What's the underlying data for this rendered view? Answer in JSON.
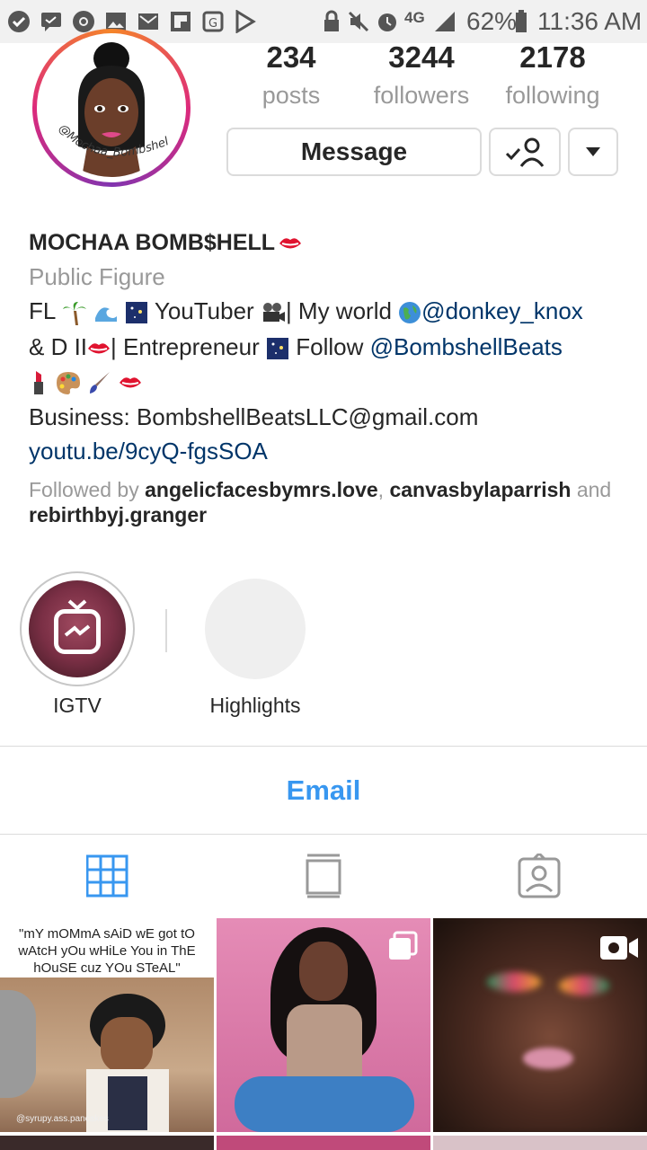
{
  "status_bar": {
    "battery": "62%",
    "time": "11:36 AM",
    "network": "4G"
  },
  "profile": {
    "avatar_caption": "@Mochaa_Bombshell",
    "stats": [
      {
        "value": "234",
        "label": "posts"
      },
      {
        "value": "3244",
        "label": "followers"
      },
      {
        "value": "2178",
        "label": "following"
      }
    ],
    "message_button": "Message"
  },
  "bio": {
    "name": "MOCHAA BOMB$HELL",
    "category": "Public Figure",
    "line1_prefix": "FL",
    "line1_mid": "YouTuber",
    "line1_text": "| My world",
    "line1_link": "@donkey_knox",
    "line2_prefix": "& D II",
    "line2_text": "| Entrepreneur",
    "line2_follow": "Follow",
    "line2_link": "@BombshellBeats",
    "business": "Business: BombshellBeatsLLC@gmail.com",
    "website": "youtu.be/9cyQ-fgsSOA",
    "followed_prefix": "Followed by",
    "followed_user1": "angelicfacesbymrs.love",
    "followed_user2": "canvasbylaparrish",
    "followed_and": "and",
    "followed_user3": "rebirthbyj.granger"
  },
  "highlights": [
    {
      "label": "IGTV",
      "icon": "igtv-icon"
    },
    {
      "label": "Highlights",
      "icon": "empty-highlight"
    }
  ],
  "contact": {
    "email_label": "Email"
  },
  "tabs": [
    {
      "name": "grid",
      "icon": "grid-icon",
      "active": true
    },
    {
      "name": "feed",
      "icon": "feed-icon",
      "active": false
    },
    {
      "name": "tagged",
      "icon": "tagged-icon",
      "active": false
    }
  ],
  "posts": [
    {
      "caption": "\"mY mOMmA sAiD wE got tO wAtcH yOu wHiLe You in ThE hOuSE cuz YOu STeAL\"",
      "watermark": "@syrupy.ass.pancakes"
    },
    {
      "type": "carousel"
    },
    {
      "type": "video"
    }
  ],
  "colors": {
    "accent_blue": "#3897f0",
    "link_blue": "#003569",
    "muted_gray": "#999999",
    "border_gray": "#dbdbdb"
  }
}
